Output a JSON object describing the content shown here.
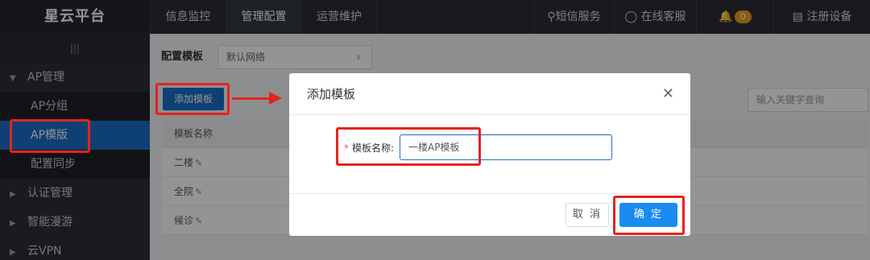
{
  "brand": "星云平台",
  "nav": [
    {
      "label": "信息监控"
    },
    {
      "label": "管理配置"
    },
    {
      "label": "运营维护"
    }
  ],
  "top_right": {
    "sms": "短信服务",
    "chat": "在线客服",
    "notify_count": "0",
    "register": "注册设备"
  },
  "sidebar": {
    "collapse": "|||",
    "items": [
      {
        "label": "AP管理"
      },
      {
        "label": "AP分组"
      },
      {
        "label": "AP模版"
      },
      {
        "label": "配置同步"
      },
      {
        "label": "认证管理"
      },
      {
        "label": "智能漫游"
      },
      {
        "label": "云VPN"
      }
    ]
  },
  "main": {
    "config_label": "配置模板",
    "config_select": "默认网络",
    "add_button": "添加模板",
    "search_placeholder": "输入关键字查询",
    "table_header": "模板名称",
    "rows": [
      "二楼",
      "全院",
      "候诊"
    ]
  },
  "modal": {
    "title": "添加模板",
    "field_label": "模板名称:",
    "field_value": "一楼AP模板",
    "cancel": "取 消",
    "ok": "确 定"
  },
  "colors": {
    "accent": "#1a6fc9",
    "highlight": "#e4231f",
    "topbar": "#2a2d33"
  }
}
